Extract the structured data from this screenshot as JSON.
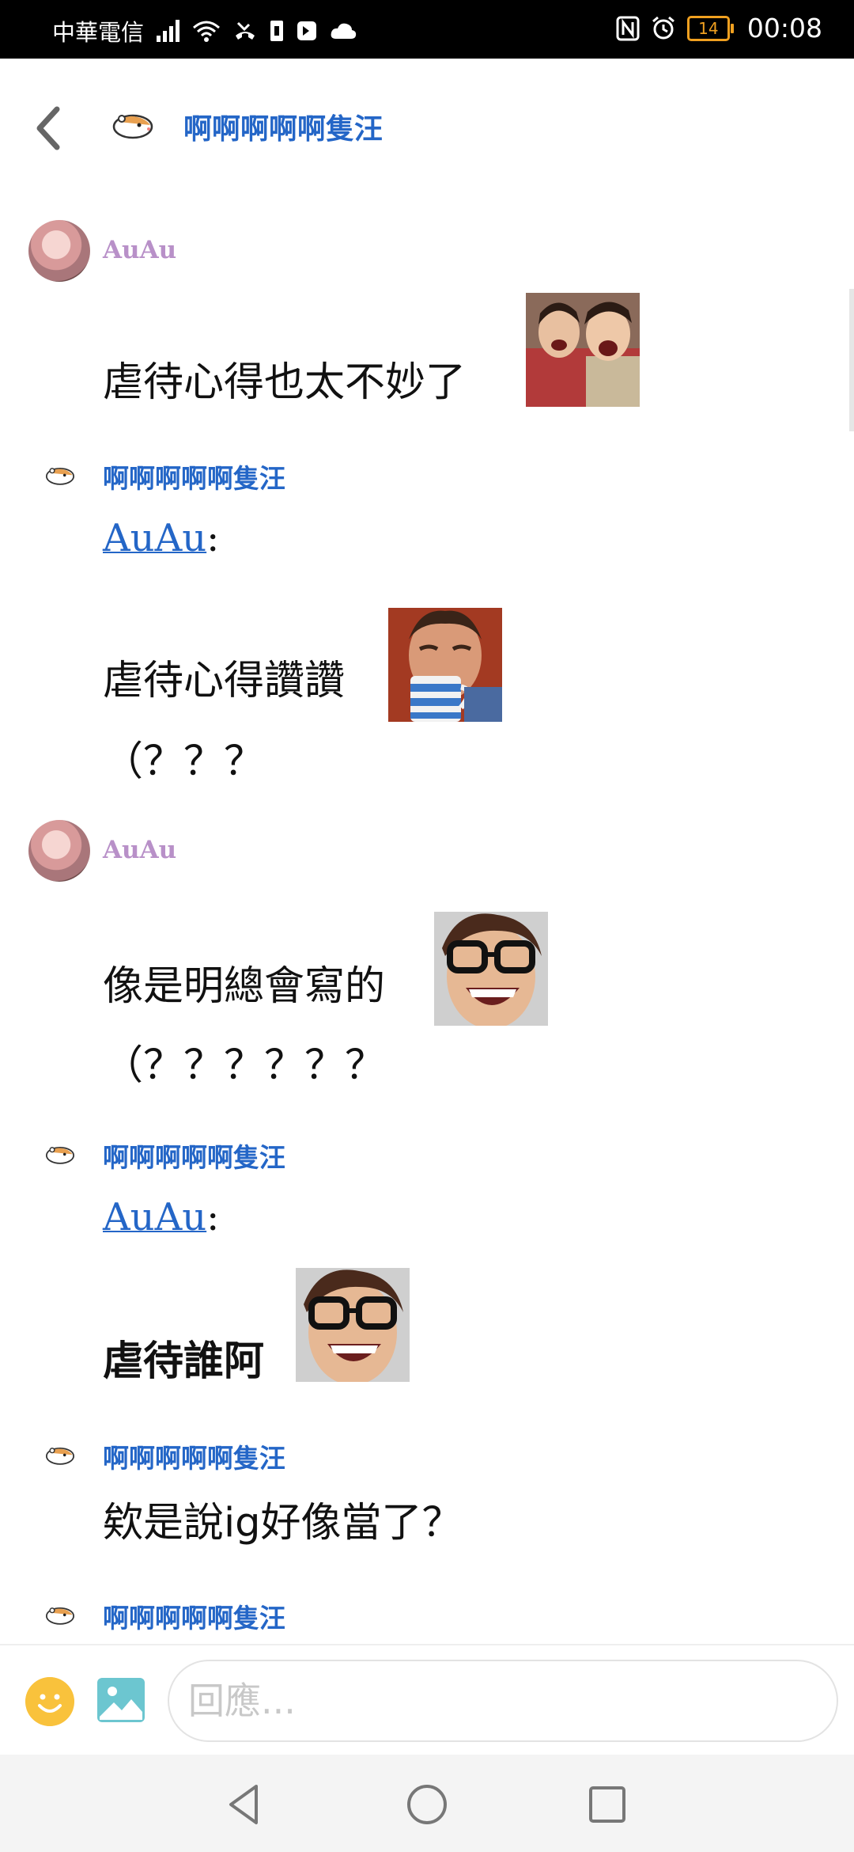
{
  "status_bar": {
    "carrier": "中華電信",
    "battery": "14",
    "time": "00:08"
  },
  "header": {
    "title": "啊啊啊啊啊隻汪"
  },
  "messages": [
    {
      "sender": "AuAu",
      "lines": [
        "虐待心得也太不妙了"
      ],
      "sticker": "laughing-men-sticker"
    },
    {
      "sender": "啊啊啊啊啊隻汪",
      "mention": "AuAu",
      "lines": [
        "虐待心得讚讚",
        "（？？？"
      ],
      "sticker": "man-drinking-mug-sticker"
    },
    {
      "sender": "AuAu",
      "lines": [
        "像是明總會寫的",
        "（？？？？？？"
      ],
      "sticker": "glasses-guy-sticker"
    },
    {
      "sender": "啊啊啊啊啊隻汪",
      "mention": "AuAu",
      "lines": [
        "虐待誰阿"
      ],
      "sticker": "glasses-guy-sticker"
    },
    {
      "sender": "啊啊啊啊啊隻汪",
      "lines": [
        "欸是說ig好像當了？"
      ]
    },
    {
      "sender": "啊啊啊啊啊隻汪"
    }
  ],
  "mention_colon": ":",
  "composer": {
    "placeholder": "回應..."
  },
  "icons": [
    "back-arrow-icon",
    "hamster-icon",
    "emoji-icon",
    "image-icon",
    "nav-back-icon",
    "nav-home-icon",
    "nav-recents-icon"
  ],
  "colors": {
    "accent": "#2466c7",
    "auau_name": "#b890c8",
    "emoji": "#f9c23c",
    "image_icon": "#6cc6d0"
  }
}
